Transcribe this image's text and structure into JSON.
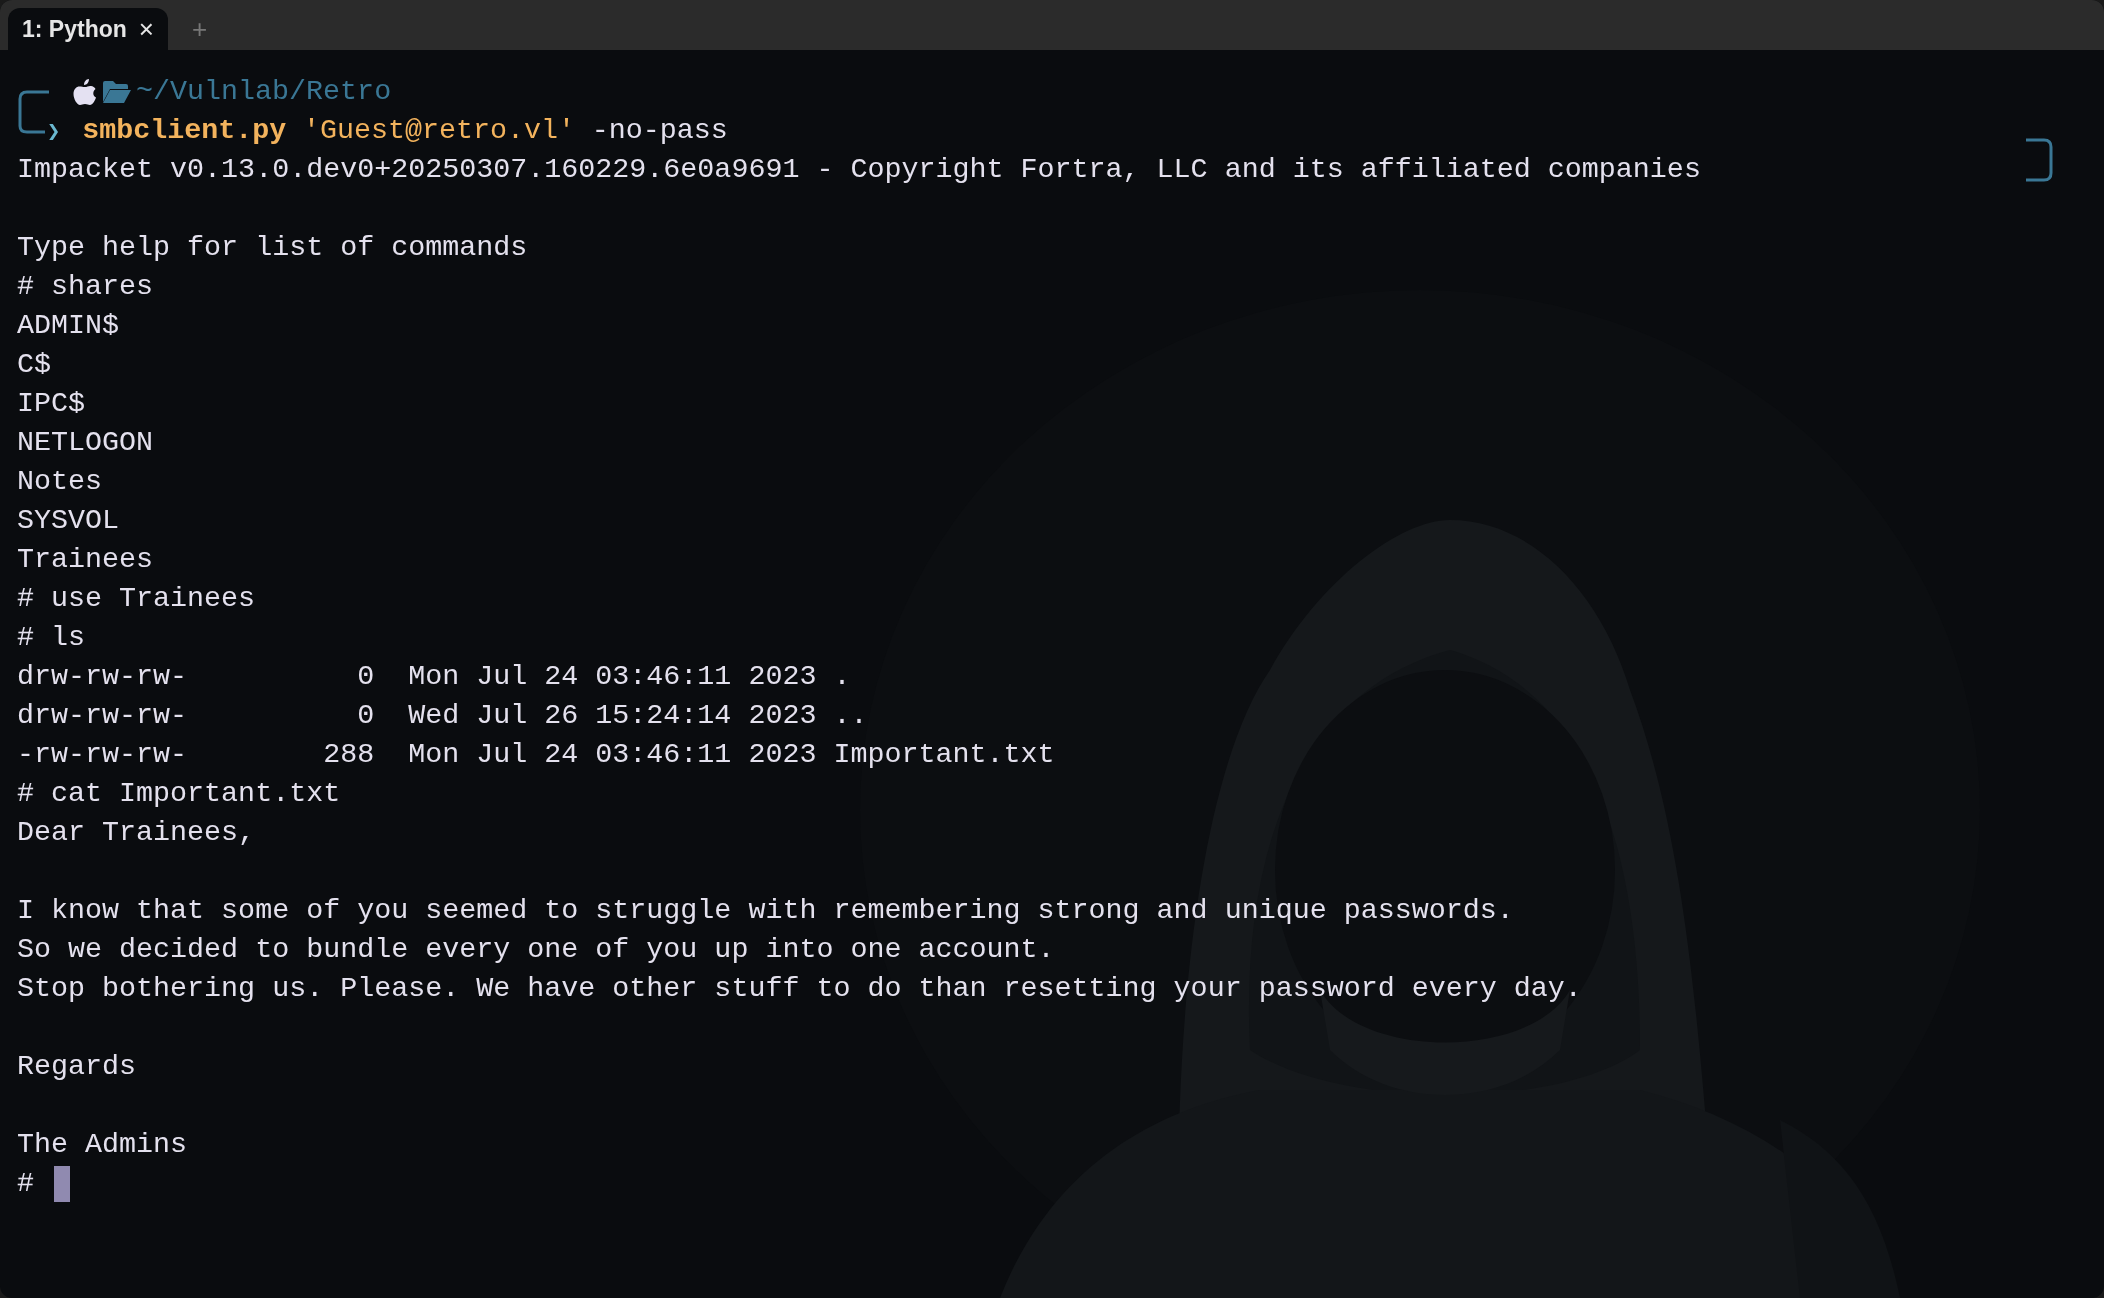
{
  "tabs": [
    {
      "label": "1: Python",
      "close": "×",
      "selected": true
    }
  ],
  "new_tab": "+",
  "prompt": {
    "path": "~/Vulnlab/Retro",
    "arrow": "❯",
    "command": "smbclient.py",
    "argument": "'Guest@retro.vl'",
    "flag": "-no-pass"
  },
  "lines": [
    {
      "kind": "text",
      "text": "Impacket v0.13.0.dev0+20250307.160229.6e0a9691 - Copyright Fortra, LLC and its affiliated companies"
    },
    {
      "kind": "blank"
    },
    {
      "kind": "text",
      "text": "Type help for list of commands"
    },
    {
      "kind": "text",
      "text": "# shares"
    },
    {
      "kind": "text",
      "text": "ADMIN$"
    },
    {
      "kind": "text",
      "text": "C$"
    },
    {
      "kind": "text",
      "text": "IPC$"
    },
    {
      "kind": "text",
      "text": "NETLOGON"
    },
    {
      "kind": "text",
      "text": "Notes"
    },
    {
      "kind": "text",
      "text": "SYSVOL"
    },
    {
      "kind": "text",
      "text": "Trainees"
    },
    {
      "kind": "text",
      "text": "# use Trainees"
    },
    {
      "kind": "text",
      "text": "# ls"
    },
    {
      "kind": "text",
      "text": "drw-rw-rw-          0  Mon Jul 24 03:46:11 2023 ."
    },
    {
      "kind": "text",
      "text": "drw-rw-rw-          0  Wed Jul 26 15:24:14 2023 .."
    },
    {
      "kind": "text",
      "text": "-rw-rw-rw-        288  Mon Jul 24 03:46:11 2023 Important.txt"
    },
    {
      "kind": "text",
      "text": "# cat Important.txt"
    },
    {
      "kind": "text",
      "text": "Dear Trainees,"
    },
    {
      "kind": "blank"
    },
    {
      "kind": "text",
      "text": "I know that some of you seemed to struggle with remembering strong and unique passwords."
    },
    {
      "kind": "text",
      "text": "So we decided to bundle every one of you up into one account."
    },
    {
      "kind": "text",
      "text": "Stop bothering us. Please. We have other stuff to do than resetting your password every day."
    },
    {
      "kind": "blank"
    },
    {
      "kind": "text",
      "text": "Regards"
    },
    {
      "kind": "blank"
    },
    {
      "kind": "text",
      "text": "The Admins"
    }
  ],
  "input_prompt": "#"
}
